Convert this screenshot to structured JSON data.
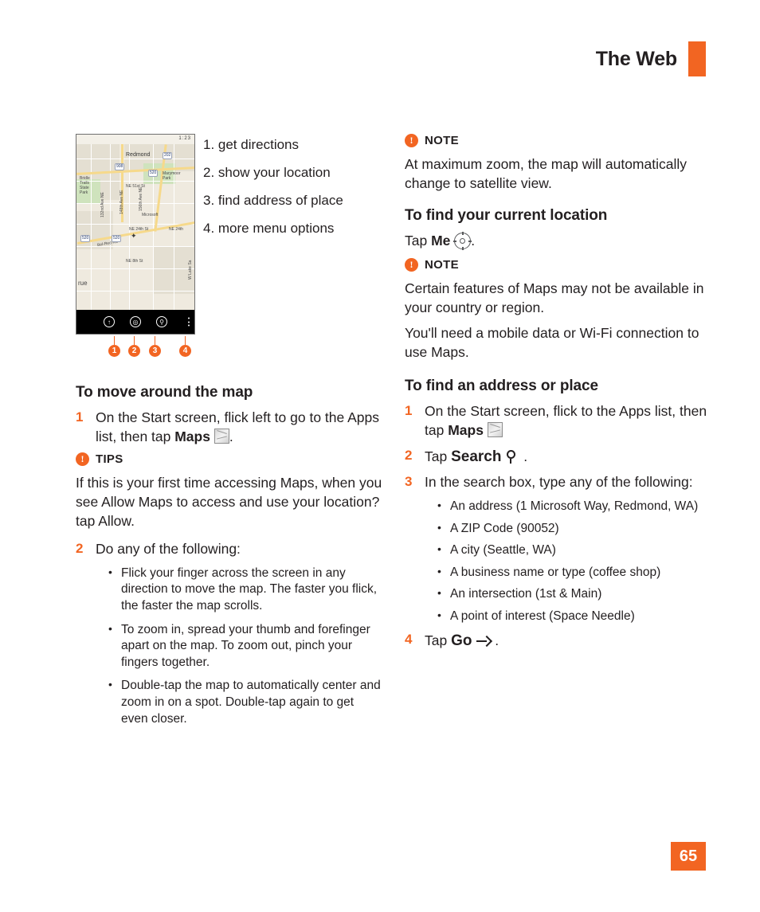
{
  "header": {
    "title": "The Web"
  },
  "page_number": "65",
  "figure": {
    "alt_name": "windows-phone-maps-screenshot",
    "status_time": "1:23",
    "map_labels": [
      "Redmond",
      "Marymoor Park",
      "Bridle Trails State Park",
      "Microsoft",
      "NE 51st St",
      "NE 24th St",
      "NE 8th St",
      "NE 24th",
      "Bel-Red Rd",
      "132nd Ave NE",
      "148th Ave NE",
      "156th Ave NE",
      "W Lake Sa",
      "rue"
    ],
    "map_shields": [
      "908",
      "520",
      "520",
      "202",
      "520"
    ],
    "callout_numbers": [
      "1",
      "2",
      "3",
      "4"
    ]
  },
  "legend": {
    "items": [
      "1. get directions",
      "2. show your location",
      "3. find address of place",
      "4. more menu options"
    ]
  },
  "left_column": {
    "heading_move": "To move around the map",
    "step1": {
      "num": "1",
      "text_a": "On the Start screen, flick left to go to the Apps list, then tap ",
      "bold": "Maps",
      "text_b": "."
    },
    "tips": {
      "label": "TIPS",
      "body": "If this is your first time accessing Maps, when you see Allow Maps to access and use your location? tap Allow."
    },
    "step2": {
      "num": "2",
      "text": "Do any of the following:"
    },
    "bullets": [
      "Flick your finger across the screen in any direction to move the map. The faster you flick, the faster the map scrolls.",
      "To zoom in, spread your thumb and forefinger apart on the map. To zoom out, pinch your fingers together.",
      "Double-tap the map to automatically center and zoom in on a spot. Double-tap again to get even closer."
    ]
  },
  "right_column": {
    "note1": {
      "label": "NOTE",
      "body": "At maximum zoom, the map will automatically change to satellite view."
    },
    "heading_current": "To find your current location",
    "tap_me": {
      "text_a": "Tap ",
      "bold": "Me",
      "text_b": "."
    },
    "note2": {
      "label": "NOTE",
      "body1": "Certain features of Maps may not be available in your country or region.",
      "body2": "You'll need a mobile data or Wi-Fi connection to use Maps."
    },
    "heading_address": "To find an address or place",
    "step1": {
      "num": "1",
      "text_a": "On the Start screen, flick to the Apps list, then tap ",
      "bold": "Maps"
    },
    "step2": {
      "num": "2",
      "text_a": "Tap ",
      "bold": "Search",
      "text_b": " ."
    },
    "step3": {
      "num": "3",
      "text": "In the search box, type any of the following:"
    },
    "bullets": [
      "An address (1 Microsoft Way, Redmond, WA)",
      "A ZIP Code (90052)",
      "A city (Seattle, WA)",
      "A business name or type (coffee shop)",
      "An intersection (1st & Main)",
      "A point of interest (Space Needle)"
    ],
    "step4": {
      "num": "4",
      "text_a": "Tap ",
      "bold": "Go",
      "text_b": " ."
    }
  }
}
